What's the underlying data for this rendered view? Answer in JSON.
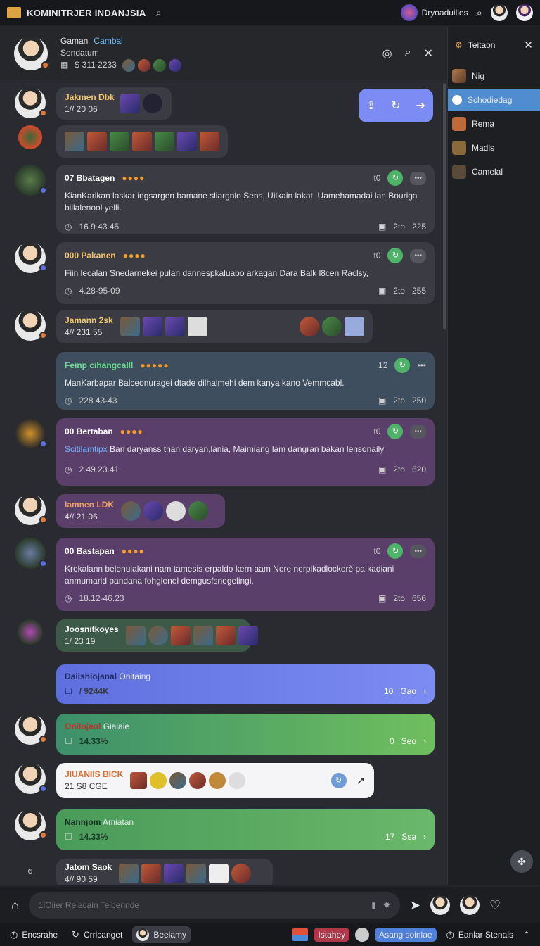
{
  "app": {
    "title": "KOMINITRJER INDANJSIA",
    "profile_name": "Dryoaduilles"
  },
  "chat_header": {
    "name": "Gaman",
    "tag": "Cambal",
    "subtitle": "Sondatum",
    "code": "S 311 2233"
  },
  "right_panel": {
    "title": "Teitaon",
    "items": [
      {
        "label": "Nig"
      },
      {
        "label": "Schodiedag"
      },
      {
        "label": "Rema"
      },
      {
        "label": "Madls"
      },
      {
        "label": "Camelal"
      }
    ]
  },
  "messages": [
    {
      "name": "Jakmen Dbk",
      "time": "1// 20 06"
    },
    {
      "name": "07 Bbatagen",
      "text": "KianKarlkan laskar ingsargen bamane sliargnlo Sens, Uilkain lakat, Uamehamadai lan Bouriga biilalenool yelli.",
      "stamp": "16.9 43.45",
      "count": "t0",
      "reactions": "2to",
      "views": "225"
    },
    {
      "name": "000 Pakanen",
      "text": "Fiin lecalan Snedarnekei pulan dannespkaluabo arkagan Dara Balk l8cen Raclsy,",
      "stamp": "4.28-95-09",
      "count": "t0",
      "reactions": "2to",
      "views": "255"
    },
    {
      "name": "Jamann 2sk",
      "time": "4// 231 55"
    },
    {
      "name": "Feinp cihangcalll",
      "text": "ManKarbapar Balceonuragei dtade dilhaimehi dem kanya kano Vemmcabl.",
      "stamp": "228 43-43",
      "count": "12",
      "reactions": "2to",
      "views": "250"
    },
    {
      "name": "00 Bertaban",
      "sender": "Scitilamtipx",
      "text": "Ban daryanss than daryan,lania, Maimiang lam dangran bakan lensonaily",
      "stamp": "2.49 23.41",
      "count": "t0",
      "reactions": "2to",
      "views": "620"
    },
    {
      "name": "Iamnen LDK",
      "time": "4// 21 06"
    },
    {
      "name": "00 Bastapan",
      "text": "Krokalann belenulakani nam tamesis erpaldo kern aam Nere nerplkadlockerè pa kadiani anmumarid pandana fohglenel demgusfsnegelingi.",
      "stamp": "18.12-46.23",
      "count": "t0",
      "reactions": "2to",
      "views": "656"
    },
    {
      "name": "Joosnitkoyes",
      "time": "1/ 23 19"
    },
    {
      "name": "Daiishiojanal",
      "tag": "Onitaing",
      "stat": "/ 9244K",
      "count": "10",
      "unit": "Gao"
    },
    {
      "name": "Onilojaol",
      "tag": "Gialaie",
      "stat": "14.33%",
      "count": "0",
      "unit": "Seo"
    },
    {
      "name": "JIUANIIS BICK",
      "time": "21 S8 CGE"
    },
    {
      "name": "Nannjom",
      "tag": "Amiatan",
      "stat": "14.33%",
      "count": "17",
      "unit": "Ssa"
    },
    {
      "name": "Jatom Saok",
      "time": "4// 90 59"
    }
  ],
  "composer": {
    "placeholder": "1lOiier Relacain Teibennde"
  },
  "bottom_bar": {
    "items": [
      {
        "label": "Encsrahe"
      },
      {
        "label": "Crricanget"
      },
      {
        "label": "Beelamy"
      },
      {
        "label": "Istahey"
      },
      {
        "label": "Asang soinlae"
      },
      {
        "label": "Eanlar Stenals"
      }
    ]
  },
  "colors": {
    "accent": "#7c8cf4",
    "green": "#4fb36a",
    "purple_bubble": "#5a3f6b"
  }
}
